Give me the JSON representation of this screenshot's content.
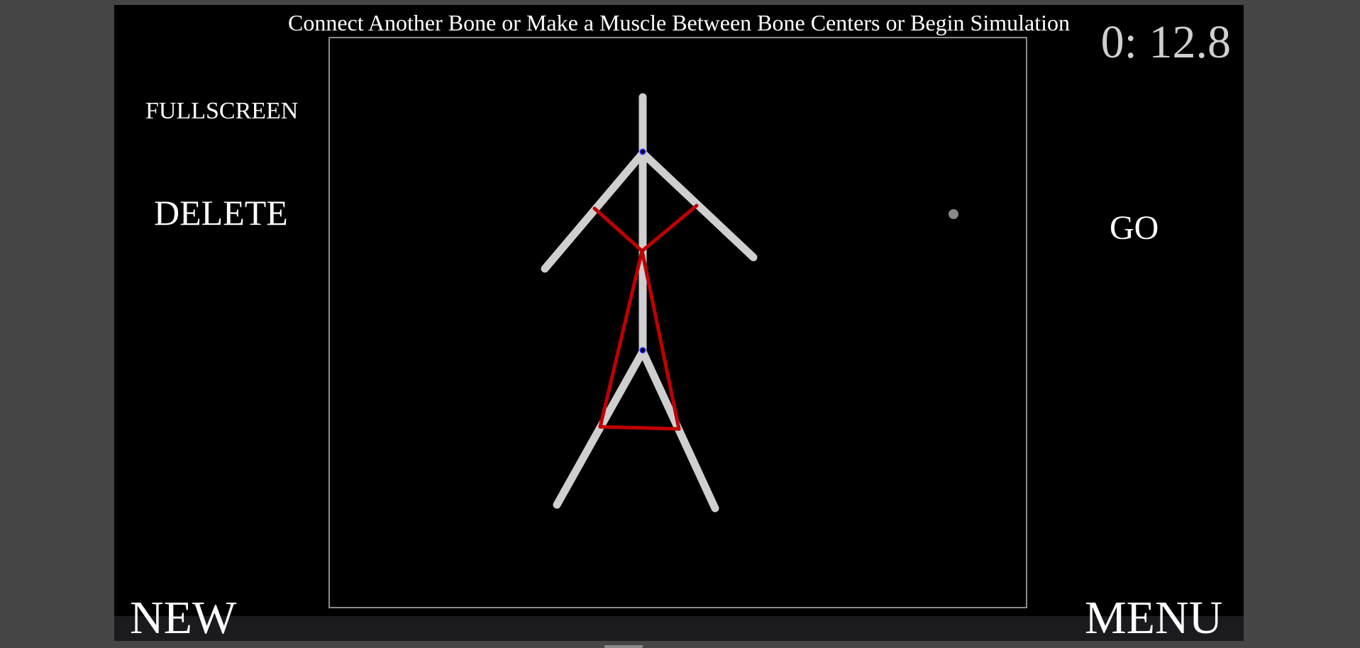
{
  "instruction": "Connect Another Bone or Make a Muscle Between Bone Centers or Begin Simulation",
  "timer": "0: 12.8",
  "buttons": {
    "fullscreen": "FULLSCREEN",
    "delete": "DELETE",
    "go": "GO",
    "new": "NEW",
    "menu": "MENU"
  },
  "colors": {
    "background": "#000000",
    "bone": "#cfcfcf",
    "muscle": "#c00000",
    "joint": "#1e1eff",
    "frame": "#8a8a8a",
    "text": "#ffffff",
    "timer": "#cfcfcf"
  },
  "creature": {
    "bones": [
      "spine",
      "left-arm",
      "right-arm",
      "left-leg",
      "right-leg"
    ],
    "muscles": [
      "left-arm-muscle",
      "right-arm-muscle",
      "left-leg-muscle",
      "right-leg-muscle",
      "hip-muscle"
    ],
    "joints": [
      "shoulder-joint",
      "hip-joint"
    ]
  }
}
